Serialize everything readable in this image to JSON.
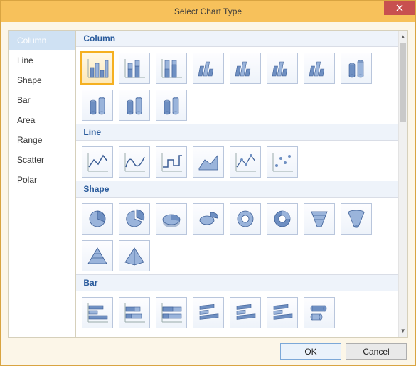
{
  "window": {
    "title": "Select Chart Type"
  },
  "sidebar": {
    "items": [
      {
        "label": "Column",
        "selected": true
      },
      {
        "label": "Line"
      },
      {
        "label": "Shape"
      },
      {
        "label": "Bar"
      },
      {
        "label": "Area"
      },
      {
        "label": "Range"
      },
      {
        "label": "Scatter"
      },
      {
        "label": "Polar"
      }
    ]
  },
  "groups": [
    {
      "title": "Column",
      "thumbs": [
        {
          "name": "column-clustered-2d",
          "icon": "bars2d",
          "selected": true
        },
        {
          "name": "column-stacked-2d",
          "icon": "bars2d-stacked"
        },
        {
          "name": "column-100stacked-2d",
          "icon": "bars2d-100"
        },
        {
          "name": "column-clustered-3d",
          "icon": "bars3d"
        },
        {
          "name": "column-stacked-3d",
          "icon": "bars3d-stacked"
        },
        {
          "name": "column-100stacked-3d",
          "icon": "bars3d-100"
        },
        {
          "name": "column-3d",
          "icon": "bars3d-depth"
        },
        {
          "name": "cylinder-clustered",
          "icon": "cyl"
        },
        {
          "name": "cylinder-stacked",
          "icon": "cyl-stacked"
        },
        {
          "name": "cylinder-100stacked",
          "icon": "cyl-100"
        },
        {
          "name": "cylinder-3d",
          "icon": "cyl-depth"
        }
      ]
    },
    {
      "title": "Line",
      "thumbs": [
        {
          "name": "line-basic",
          "icon": "line"
        },
        {
          "name": "line-smooth",
          "icon": "spline"
        },
        {
          "name": "line-step",
          "icon": "step"
        },
        {
          "name": "line-area3d",
          "icon": "line3d"
        },
        {
          "name": "line-markers",
          "icon": "line-markers"
        },
        {
          "name": "line-scatter",
          "icon": "line-scatter"
        }
      ]
    },
    {
      "title": "Shape",
      "thumbs": [
        {
          "name": "pie-2d",
          "icon": "pie"
        },
        {
          "name": "pie-exploded",
          "icon": "pie-exploded"
        },
        {
          "name": "pie-3d",
          "icon": "pie3d"
        },
        {
          "name": "pie-3d-exploded",
          "icon": "pie3d-exploded"
        },
        {
          "name": "doughnut",
          "icon": "doughnut"
        },
        {
          "name": "doughnut-exploded",
          "icon": "doughnut2"
        },
        {
          "name": "funnel",
          "icon": "funnel"
        },
        {
          "name": "funnel-3d",
          "icon": "funnel3d"
        },
        {
          "name": "pyramid-2d",
          "icon": "pyramid2d"
        },
        {
          "name": "pyramid-3d",
          "icon": "pyramid3d"
        }
      ]
    },
    {
      "title": "Bar",
      "thumbs": [
        {
          "name": "bar-clustered-2d",
          "icon": "hbar"
        },
        {
          "name": "bar-stacked-2d",
          "icon": "hbar-stacked"
        },
        {
          "name": "bar-100stacked-2d",
          "icon": "hbar-100"
        },
        {
          "name": "bar-clustered-3d",
          "icon": "hbar3d"
        },
        {
          "name": "bar-stacked-3d",
          "icon": "hbar3d-stacked"
        },
        {
          "name": "bar-100stacked-3d",
          "icon": "hbar3d-100"
        },
        {
          "name": "bar-cylinder",
          "icon": "hcyl"
        }
      ]
    }
  ],
  "buttons": {
    "ok": "OK",
    "cancel": "Cancel"
  }
}
